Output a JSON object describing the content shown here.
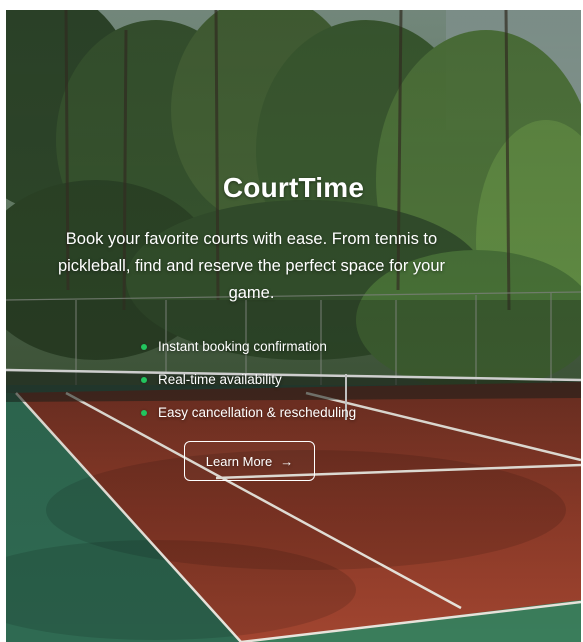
{
  "hero": {
    "title": "CourtTime",
    "subtitle": "Book your favorite courts with ease. From tennis to pickleball, find and reserve the perfect space for your game.",
    "features": [
      {
        "label": "Instant booking confirmation"
      },
      {
        "label": "Real-time availability"
      },
      {
        "label": "Easy cancellation & rescheduling"
      }
    ],
    "cta": {
      "label": "Learn More",
      "icon": "arrow-right-icon",
      "icon_glyph": "→"
    },
    "accent_color": "#22c55e",
    "background_image": "tennis-court-photo"
  }
}
